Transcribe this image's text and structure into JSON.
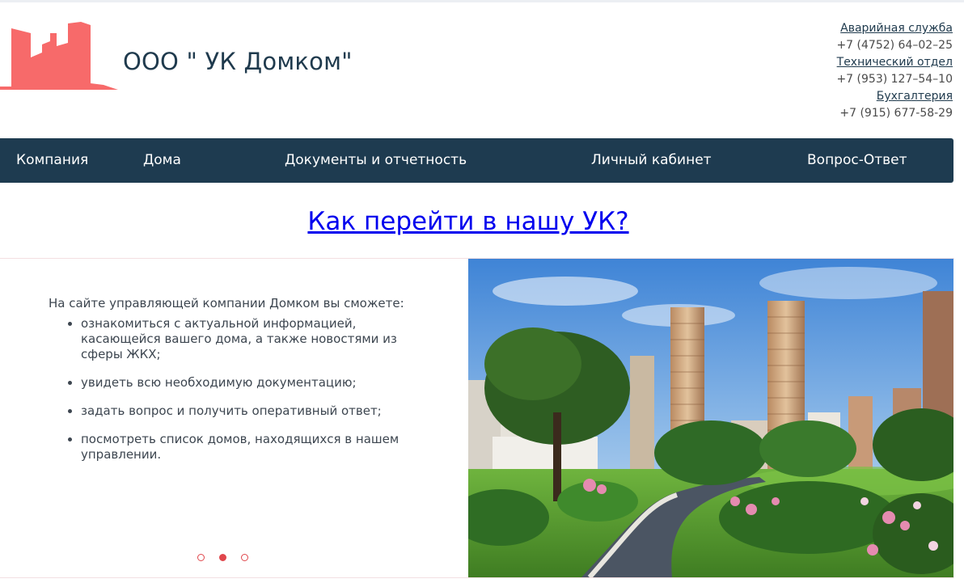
{
  "brand": {
    "title": "ООО \" УК Домком\"",
    "logo_color": "#f76a6a"
  },
  "contacts": [
    {
      "label": "Аварийная служба",
      "phone": "+7 (4752) 64–02–25"
    },
    {
      "label": "Технический отдел",
      "phone": "+7 (953) 127–54–10"
    },
    {
      "label": "Бухгалтерия",
      "phone": "+7 (915) 677-58-29"
    }
  ],
  "nav": {
    "background": "#1e3b50",
    "items": [
      {
        "label": "Компания"
      },
      {
        "label": "Дома"
      },
      {
        "label": "Документы и отчетность"
      },
      {
        "label": "Личный кабинет"
      },
      {
        "label": "Вопрос-Ответ"
      }
    ]
  },
  "headline": {
    "label": "Как перейти в нашу УК?",
    "color": "#0000ee"
  },
  "slider": {
    "intro": "На сайте управляющей компании Домком вы сможете:",
    "bullets": [
      "ознакомиться с актуальной информацией, касающейся вашего дома, а также новостями из сферы ЖКХ;",
      "увидеть всю необходимую документацию;",
      "задать вопрос и получить оперативный ответ;",
      "посмотреть список домов, находящихся в нашем управлении."
    ],
    "dots": {
      "count": 3,
      "active_index": 1,
      "color": "#e0474c"
    },
    "image": "residential-park-photo"
  }
}
